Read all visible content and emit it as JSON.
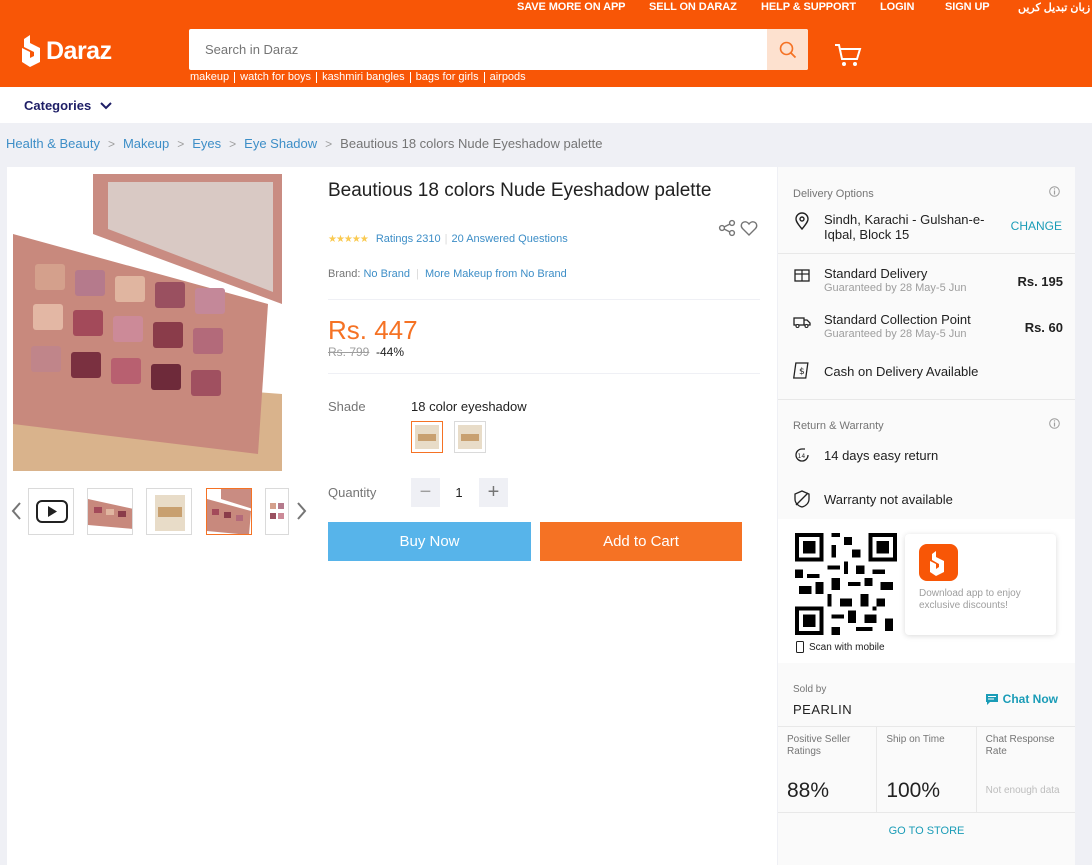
{
  "topbar": {
    "links": [
      "SAVE MORE ON APP",
      "SELL ON DARAZ",
      "HELP & SUPPORT",
      "LOGIN",
      "SIGN UP",
      "زبان تبدیل کریں"
    ],
    "logo_text": "Daraz",
    "brand_color": "#f85606"
  },
  "search": {
    "placeholder": "Search in Daraz",
    "suggestions": [
      "makeup",
      "watch for boys",
      "kashmiri bangles",
      "bags for girls",
      "airpods"
    ]
  },
  "nav": {
    "categories_label": "Categories"
  },
  "breadcrumb": [
    "Health & Beauty",
    "Makeup",
    "Eyes",
    "Eye Shadow",
    "Beautious 18 colors Nude Eyeshadow palette"
  ],
  "product": {
    "title": "Beautious 18 colors Nude Eyeshadow palette",
    "ratings_label": "Ratings 2310",
    "questions_label": "20 Answered Questions",
    "rating_value": 4.5,
    "brand_label": "Brand:",
    "brand_value": "No Brand",
    "more_brand_label": "More Makeup from No Brand",
    "price": "Rs. 447",
    "old_price": "Rs. 799",
    "discount": "-44%",
    "shade_label": "Shade",
    "shade_value": "18 color eyeshadow",
    "quantity_label": "Quantity",
    "quantity_value": "1",
    "buy_now": "Buy Now",
    "add_to_cart": "Add to Cart",
    "price_color": "#f57224"
  },
  "delivery": {
    "heading": "Delivery Options",
    "location": "Sindh, Karachi - Gulshan-e-Iqbal, Block 15",
    "change": "CHANGE",
    "options": [
      {
        "name": "Standard Delivery",
        "sub": "Guaranteed by 28 May-5 Jun",
        "price": "Rs. 195"
      },
      {
        "name": "Standard Collection Point",
        "sub": "Guaranteed by 28 May-5 Jun",
        "price": "Rs. 60"
      }
    ],
    "cod": "Cash on Delivery Available"
  },
  "warranty": {
    "heading": "Return & Warranty",
    "return": "14 days easy return",
    "warranty": "Warranty not available"
  },
  "app": {
    "download_text": "Download app to enjoy exclusive discounts!",
    "scan_text": "Scan with mobile"
  },
  "seller": {
    "sold_by": "Sold by",
    "name": "PEARLIN",
    "chat": "Chat Now",
    "stats": [
      {
        "label": "Positive Seller Ratings",
        "value": "88%"
      },
      {
        "label": "Ship on Time",
        "value": "100%"
      },
      {
        "label": "Chat Response Rate",
        "value": "Not enough data"
      }
    ],
    "go_to_store": "GO TO STORE"
  }
}
